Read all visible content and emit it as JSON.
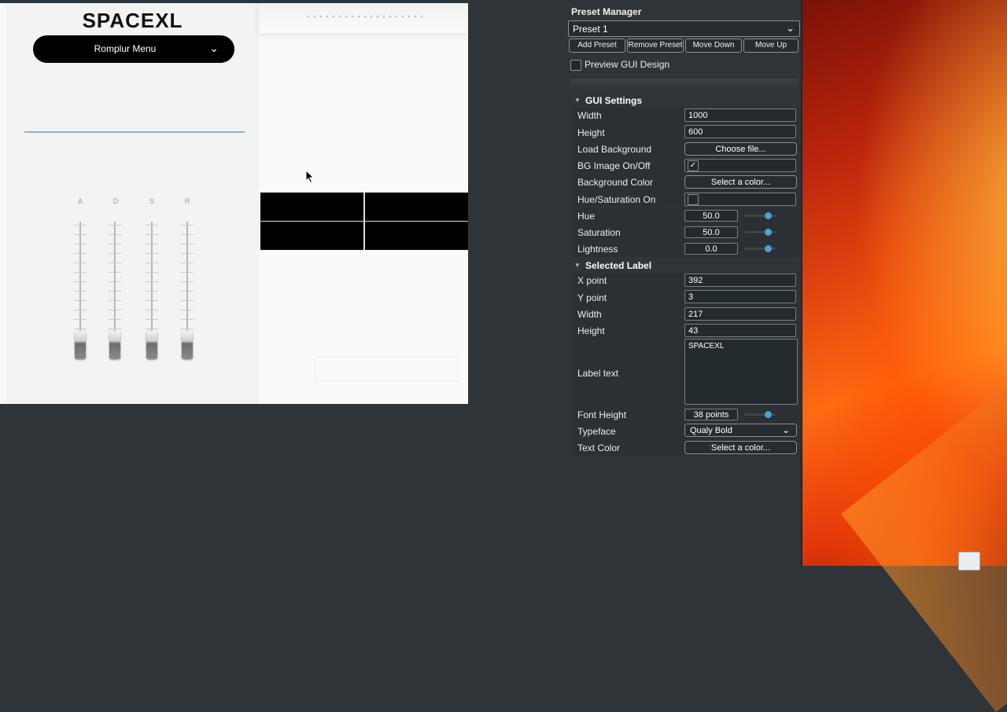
{
  "colors": {
    "panel_bg": "#2e3437",
    "accent": "#4aa3d0",
    "menu_bg": "#000000",
    "teal_line": "#8fb6c2"
  },
  "preview": {
    "logo": "SPACEXL",
    "menu_label": "Romplur Menu",
    "adsr_labels": [
      "A",
      "D",
      "S",
      "R"
    ]
  },
  "panel": {
    "title": "Preset Manager",
    "preset_selected": "Preset 1",
    "buttons": {
      "add": "Add Preset",
      "remove": "Remove Preset",
      "move_down": "Move Down",
      "move_up": "Move Up"
    },
    "preview_label": "Preview GUI Design",
    "preview_checked": false,
    "gui_settings": {
      "title": "GUI Settings",
      "width_label": "Width",
      "width_value": "1000",
      "height_label": "Height",
      "height_value": "600",
      "load_bg_label": "Load Background",
      "load_bg_button": "Choose file...",
      "bg_image_label": "BG Image On/Off",
      "bg_image_checked": true,
      "bg_color_label": "Background Color",
      "bg_color_button": "Select a color...",
      "hue_sat_label": "Hue/Saturation On",
      "hue_sat_checked": false,
      "hue_label": "Hue",
      "hue_value": "50.0",
      "saturation_label": "Saturation",
      "saturation_value": "50.0",
      "lightness_label": "Lightness",
      "lightness_value": "0.0"
    },
    "selected_label": {
      "title": "Selected Label",
      "x_label": "X point",
      "x_value": "392",
      "y_label": "Y point",
      "y_value": "3",
      "width_label": "Width",
      "width_value": "217",
      "height_label": "Height",
      "height_value": "43",
      "text_label": "Label text",
      "text_value": "SPACEXL",
      "font_height_label": "Font Height",
      "font_height_value": "38 points",
      "typeface_label": "Typeface",
      "typeface_value": "Qualy Bold",
      "text_color_label": "Text Color",
      "text_color_button": "Select a color..."
    }
  }
}
